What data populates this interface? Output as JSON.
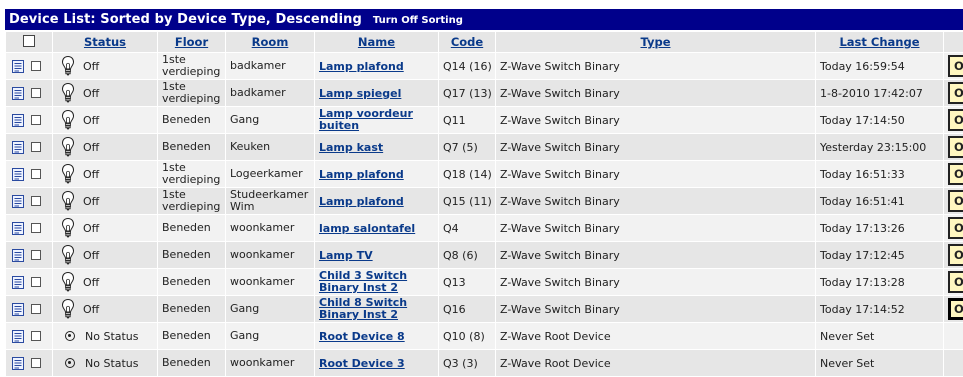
{
  "header": {
    "title": "Device List: Sorted by Device Type, Descending",
    "sort_toggle": "Turn Off Sorting"
  },
  "columns": {
    "status": "Status",
    "floor": "Floor",
    "room": "Room",
    "name": "Name",
    "code": "Code",
    "type": "Type",
    "last_change": "Last Change"
  },
  "rows": [
    {
      "status": "Off",
      "floor": "1ste verdieping",
      "room": "badkamer",
      "name": "Lamp plafond",
      "code": "Q14 (16)",
      "type": "Z-Wave Switch Binary",
      "last_change": "Today 16:59:54",
      "action": "On",
      "icon": "bulb-icon"
    },
    {
      "status": "Off",
      "floor": "1ste verdieping",
      "room": "badkamer",
      "name": "Lamp spiegel",
      "code": "Q17 (13)",
      "type": "Z-Wave Switch Binary",
      "last_change": "1-8-2010 17:42:07",
      "action": "On",
      "icon": "bulb-icon"
    },
    {
      "status": "Off",
      "floor": "Beneden",
      "room": "Gang",
      "name": "Lamp voordeur buiten",
      "code": "Q11",
      "type": "Z-Wave Switch Binary",
      "last_change": "Today 17:14:50",
      "action": "On",
      "icon": "bulb-icon"
    },
    {
      "status": "Off",
      "floor": "Beneden",
      "room": "Keuken",
      "name": "Lamp kast",
      "code": "Q7 (5)",
      "type": "Z-Wave Switch Binary",
      "last_change": "Yesterday 23:15:00",
      "action": "On",
      "icon": "bulb-icon"
    },
    {
      "status": "Off",
      "floor": "1ste verdieping",
      "room": "Logeerkamer",
      "name": "Lamp plafond",
      "code": "Q18 (14)",
      "type": "Z-Wave Switch Binary",
      "last_change": "Today 16:51:33",
      "action": "On",
      "icon": "bulb-icon"
    },
    {
      "status": "Off",
      "floor": "1ste verdieping",
      "room": "Studeerkamer Wim",
      "name": "Lamp plafond",
      "code": "Q15 (11)",
      "type": "Z-Wave Switch Binary",
      "last_change": "Today 16:51:41",
      "action": "On",
      "icon": "bulb-icon"
    },
    {
      "status": "Off",
      "floor": "Beneden",
      "room": "woonkamer",
      "name": "lamp salontafel",
      "code": "Q4",
      "type": "Z-Wave Switch Binary",
      "last_change": "Today 17:13:26",
      "action": "On",
      "icon": "bulb-icon"
    },
    {
      "status": "Off",
      "floor": "Beneden",
      "room": "woonkamer",
      "name": "Lamp TV",
      "code": "Q8 (6)",
      "type": "Z-Wave Switch Binary",
      "last_change": "Today 17:12:45",
      "action": "On",
      "icon": "bulb-icon"
    },
    {
      "status": "Off",
      "floor": "Beneden",
      "room": "woonkamer",
      "name": "Child 3 Switch Binary Inst 2",
      "code": "Q13",
      "type": "Z-Wave Switch Binary",
      "last_change": "Today 17:13:28",
      "action": "On",
      "icon": "bulb-icon"
    },
    {
      "status": "Off",
      "floor": "Beneden",
      "room": "Gang",
      "name": "Child 8 Switch Binary Inst 2",
      "code": "Q16",
      "type": "Z-Wave Switch Binary",
      "last_change": "Today 17:14:52",
      "action": "On",
      "icon": "bulb-icon"
    },
    {
      "status": "No Status",
      "floor": "Beneden",
      "room": "Gang",
      "name": "Root Device 8",
      "code": "Q10 (8)",
      "type": "Z-Wave Root Device",
      "last_change": "Never Set",
      "action": "",
      "icon": "radio-icon"
    },
    {
      "status": "No Status",
      "floor": "Beneden",
      "room": "woonkamer",
      "name": "Root Device 3",
      "code": "Q3 (3)",
      "type": "Z-Wave Root Device",
      "last_change": "Never Set",
      "action": "",
      "icon": "radio-icon"
    }
  ]
}
